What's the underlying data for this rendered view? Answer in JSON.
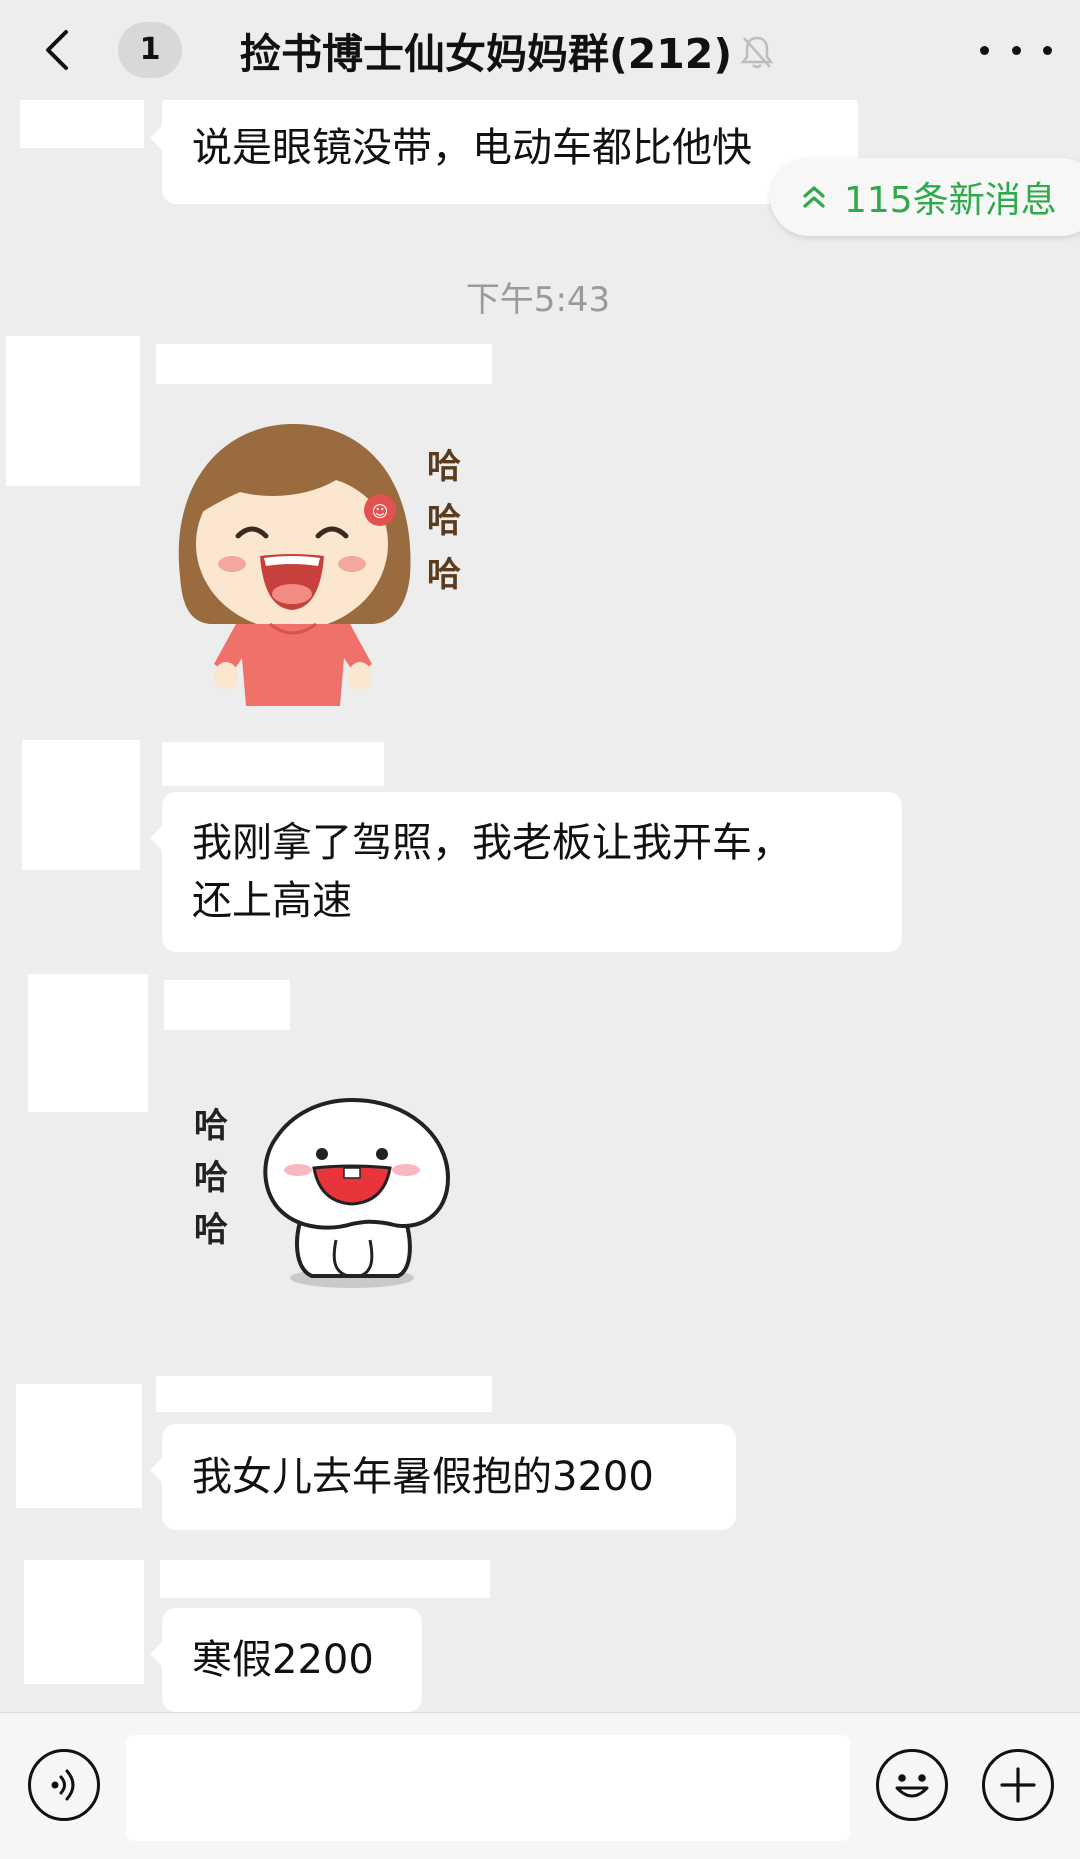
{
  "header": {
    "unread_count": "1",
    "title": "捡书博士仙女妈妈群(212)",
    "icons": [
      "chevron-left-icon",
      "bell-mute-icon",
      "more-icon"
    ]
  },
  "new_messages": {
    "label": "115条新消息",
    "icon": "double-chevron-up-icon",
    "color": "#2fa94a"
  },
  "time_divider": "下午5:43",
  "messages": [
    {
      "type": "text",
      "text": "说是眼镜没带，电动车都比他快"
    },
    {
      "type": "sticker",
      "sticker": "laughing-girl-sticker",
      "sticker_text": [
        "哈",
        "哈",
        "哈"
      ]
    },
    {
      "type": "text",
      "lines": [
        "我刚拿了驾照，我老板让我开车，",
        "还上高速"
      ]
    },
    {
      "type": "sticker",
      "sticker": "laughing-blob-sticker",
      "sticker_text": [
        "哈",
        "哈",
        "哈"
      ]
    },
    {
      "type": "text",
      "text": "我女儿去年暑假抱的3200"
    },
    {
      "type": "text",
      "text": "寒假2200"
    }
  ],
  "input_bar": {
    "value": "",
    "icons": [
      "voice-icon",
      "emoji-icon",
      "plus-icon"
    ]
  }
}
